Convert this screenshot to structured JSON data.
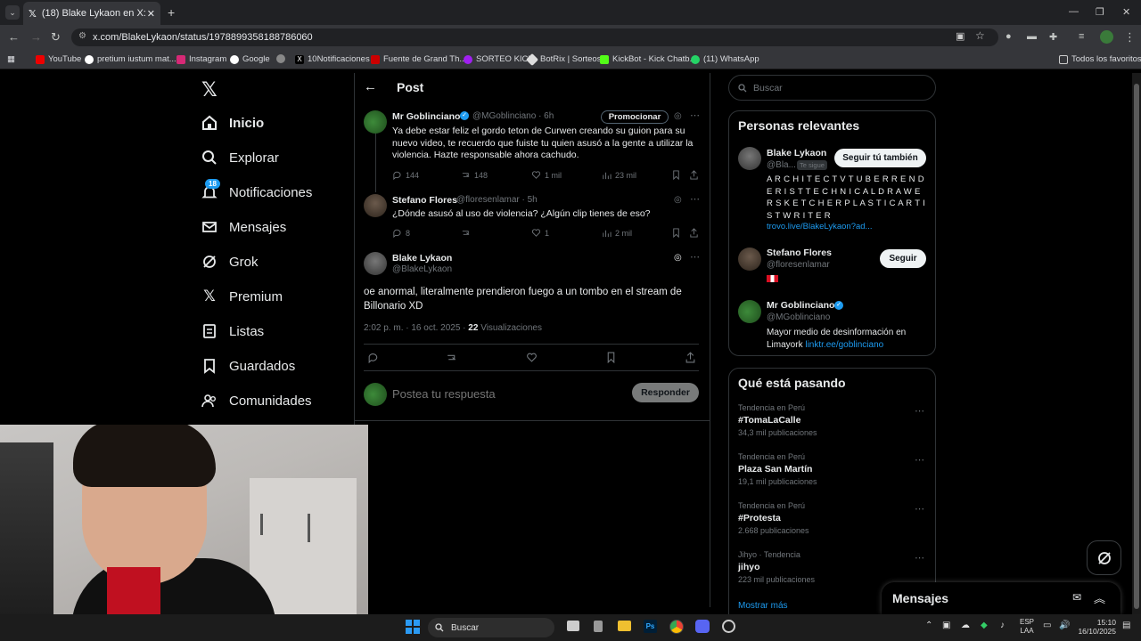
{
  "browser": {
    "tab_title": "(18) Blake Lykaon en X: \"@flore…",
    "url": "x.com/BlakeLykaon/status/1978899358188786060",
    "bookmarks": [
      "YouTube",
      "pretium iustum mat...",
      "Instagram",
      "Google",
      "10Notificaciones",
      "Fuente de Grand Th...",
      "SORTEO KICK",
      "BotRix | Sorteos",
      "KickBot - Kick Chatb...",
      "(11) WhatsApp"
    ],
    "all_bookmarks": "Todos los favoritos"
  },
  "nav": {
    "logo": "X",
    "items": [
      "Inicio",
      "Explorar",
      "Notificaciones",
      "Mensajes",
      "Grok",
      "Premium",
      "Listas",
      "Guardados",
      "Comunidades"
    ],
    "notif_badge": "18"
  },
  "header": {
    "title": "Post"
  },
  "posts": [
    {
      "name": "Mr Goblinciano",
      "handle": "@MGoblinciano · 6h",
      "promo": "Promocionar",
      "text": "Ya debe estar feliz el gordo teton de Curwen creando su guion para su nuevo video, te recuerdo que fuiste tu quien asusó a la gente a utilizar la violencia. Hazte responsable ahora cachudo.",
      "replies": "144",
      "reposts": "148",
      "likes": "1 mil",
      "views": "23 mil"
    },
    {
      "name": "Stefano Flores",
      "handle": "@floresenlamar · 5h",
      "text": "¿Dónde asusó al uso de violencia? ¿Algún clip tienes de eso?",
      "replies": "8",
      "reposts": "",
      "likes": "1",
      "views": "2 mil"
    }
  ],
  "main_post": {
    "name": "Blake Lykaon",
    "handle": "@BlakeLykaon",
    "text": "oe anormal, literalmente prendieron fuego a un tombo en el stream de Billonario XD",
    "date": "2:02 p. m. · 16 oct. 2025 · ",
    "views_count": "22",
    "views_label": " Visualizaciones"
  },
  "reply": {
    "placeholder": "Postea tu respuesta",
    "button": "Responder"
  },
  "search": {
    "placeholder": "Buscar"
  },
  "relevant": {
    "title": "Personas relevantes",
    "people": [
      {
        "name": "Blake Lykaon",
        "handle": "@Bla...",
        "follows": "Te sigue",
        "button": "Seguir tú también",
        "bio": "A R C H I T E C T V T U B E R R E N D E R I S T T E C H N I C A L D R A W E R S K E T C H E R P L A S T I C A R T I S T W R I T E R",
        "link": "trovo.live/BlakeLykaon?ad..."
      },
      {
        "name": "Stefano Flores",
        "handle": "@floresenlamar",
        "button": "Seguir"
      },
      {
        "name": "Mr Goblinciano",
        "handle": "@MGoblinciano",
        "bio": "Mayor medio de desinformación en Limayork ",
        "link": "linktr.ee/goblinciano"
      }
    ]
  },
  "trending": {
    "title": "Qué está pasando",
    "items": [
      {
        "ctx": "Tendencia en Perú",
        "name": "#TomaLaCalle",
        "count": "34,3 mil publicaciones"
      },
      {
        "ctx": "Tendencia en Perú",
        "name": "Plaza San Martín",
        "count": "19,1 mil publicaciones"
      },
      {
        "ctx": "Tendencia en Perú",
        "name": "#Protesta",
        "count": "2.668 publicaciones"
      },
      {
        "ctx": "Jihyo · Tendencia",
        "name": "jihyo",
        "count": "223 mil publicaciones"
      }
    ],
    "more": "Mostrar más"
  },
  "messages_dock": {
    "title": "Mensajes"
  },
  "taskbar": {
    "search": "Buscar",
    "lang": "ESP",
    "lang2": "LAA",
    "time": "15:10",
    "date": "16/10/2025"
  }
}
